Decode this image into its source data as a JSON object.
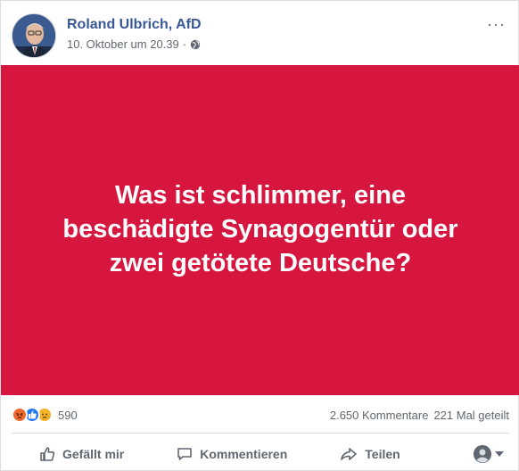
{
  "post": {
    "author": "Roland Ulbrich, AfD",
    "date": "10. Oktober um 20.39",
    "separator": "·",
    "more_label": "···"
  },
  "image": {
    "text": "Was ist schlimmer, eine beschädigte Synagogentür oder zwei getötete Deutsche?",
    "background_color": "#d6163f"
  },
  "reactions": {
    "icons": [
      "angry-icon",
      "like-icon",
      "sad-icon"
    ],
    "count": "590",
    "comments": "2.650 Kommentare",
    "shares": "221 Mal geteilt"
  },
  "actions": {
    "like_label": "Gefällt mir",
    "comment_label": "Kommentieren",
    "share_label": "Teilen"
  },
  "colors": {
    "author_link": "#385898",
    "muted_text": "#616770",
    "like_blue": "#2078f4",
    "angry_orange": "#f0672e",
    "sad_yellow": "#f7b125"
  }
}
